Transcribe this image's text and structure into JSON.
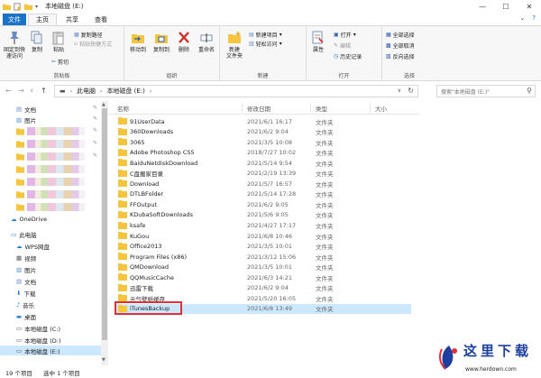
{
  "window": {
    "title": "本地磁盘 (E:)"
  },
  "tabs": [
    {
      "label": "文件"
    },
    {
      "label": "主页"
    },
    {
      "label": "共享"
    },
    {
      "label": "查看"
    }
  ],
  "ribbon": {
    "clipboard": {
      "label": "剪贴板",
      "pin": "固定到快速访问",
      "copy": "复制",
      "paste": "粘贴",
      "copy_path": "复制路径",
      "paste_shortcut": "粘贴快捷方式",
      "cut": "剪切"
    },
    "organize": {
      "label": "组织",
      "move_to": "移动到",
      "copy_to": "复制到",
      "delete": "删除",
      "rename": "重命名"
    },
    "new": {
      "label": "新建",
      "new_folder": "新建\n文件夹",
      "new_item": "新建项目",
      "easy_access": "轻松访问"
    },
    "open": {
      "label": "打开",
      "properties": "属性",
      "open": "打开",
      "edit": "编辑",
      "history": "历史记录"
    },
    "select": {
      "label": "选择",
      "select_all": "全部选择",
      "select_none": "全部取消",
      "invert": "反向选择"
    }
  },
  "address": {
    "segments": [
      "此电脑",
      "本地磁盘 (E:)"
    ],
    "search_placeholder": "搜索\"本地磁盘 (E:)\""
  },
  "nav": {
    "items": [
      {
        "label": "文档",
        "icon": "document-icon"
      },
      {
        "label": "图片",
        "icon": "picture-icon"
      },
      {
        "label": "OneDrive",
        "icon": "cloud-icon"
      },
      {
        "label": "此电脑",
        "icon": "computer-icon"
      },
      {
        "label": "WPS网盘",
        "icon": "cloud-drive-icon"
      },
      {
        "label": "视频",
        "icon": "video-icon"
      },
      {
        "label": "图片",
        "icon": "picture-icon"
      },
      {
        "label": "文档",
        "icon": "document-icon"
      },
      {
        "label": "下载",
        "icon": "download-icon"
      },
      {
        "label": "音乐",
        "icon": "music-icon"
      },
      {
        "label": "桌面",
        "icon": "desktop-icon"
      },
      {
        "label": "本地磁盘 (C:)",
        "icon": "drive-icon"
      },
      {
        "label": "本地磁盘 (D:)",
        "icon": "drive-icon"
      },
      {
        "label": "本地磁盘 (E:)",
        "icon": "drive-icon"
      }
    ]
  },
  "columns": {
    "name": "名称",
    "date": "修改日期",
    "type": "类型",
    "size": "大小"
  },
  "files": [
    {
      "name": "91UserData",
      "date": "2021/6/1 16:17",
      "type": "文件夹"
    },
    {
      "name": "360Downloads",
      "date": "2021/6/2 9:04",
      "type": "文件夹"
    },
    {
      "name": "3065",
      "date": "2021/3/5 10:08",
      "type": "文件夹"
    },
    {
      "name": "Adobe Photoshop CS5",
      "date": "2018/7/27 10:02",
      "type": "文件夹"
    },
    {
      "name": "BaiduNetdiskDownload",
      "date": "2021/5/14 9:54",
      "type": "文件夹"
    },
    {
      "name": "C盘搬家目录",
      "date": "2021/2/19 13:39",
      "type": "文件夹"
    },
    {
      "name": "Download",
      "date": "2021/5/7 16:57",
      "type": "文件夹"
    },
    {
      "name": "DTLBFolder",
      "date": "2021/5/14 17:28",
      "type": "文件夹"
    },
    {
      "name": "FFOutput",
      "date": "2021/6/2 9:05",
      "type": "文件夹"
    },
    {
      "name": "KDubaSoftDownloads",
      "date": "2021/5/6 9:05",
      "type": "文件夹"
    },
    {
      "name": "ksafe",
      "date": "2021/4/27 17:17",
      "type": "文件夹"
    },
    {
      "name": "KuGou",
      "date": "2021/6/8 10:46",
      "type": "文件夹"
    },
    {
      "name": "Office2013",
      "date": "2021/3/5 10:01",
      "type": "文件夹"
    },
    {
      "name": "Program Files (x86)",
      "date": "2021/3/12 15:06",
      "type": "文件夹"
    },
    {
      "name": "QMDownload",
      "date": "2021/3/5 10:01",
      "type": "文件夹"
    },
    {
      "name": "QQMusicCache",
      "date": "2021/6/3 14:21",
      "type": "文件夹"
    },
    {
      "name": "迅雷下载",
      "date": "2021/6/2 9:04",
      "type": "文件夹"
    },
    {
      "name": "元气壁纸缓存",
      "date": "2021/5/20 16:05",
      "type": "文件夹"
    },
    {
      "name": "iTunesBackup",
      "date": "2021/6/8 13:49",
      "type": "文件夹"
    }
  ],
  "status": {
    "count": "19 个项目",
    "selected": "选中 1 个项目"
  },
  "watermark": {
    "title": "这里下载",
    "url": "www.herdown.com"
  },
  "colors": {
    "accent": "#1a73c6",
    "selection": "#cce8ff",
    "folder": "#f4c53d",
    "highlight": "#e0303a"
  }
}
